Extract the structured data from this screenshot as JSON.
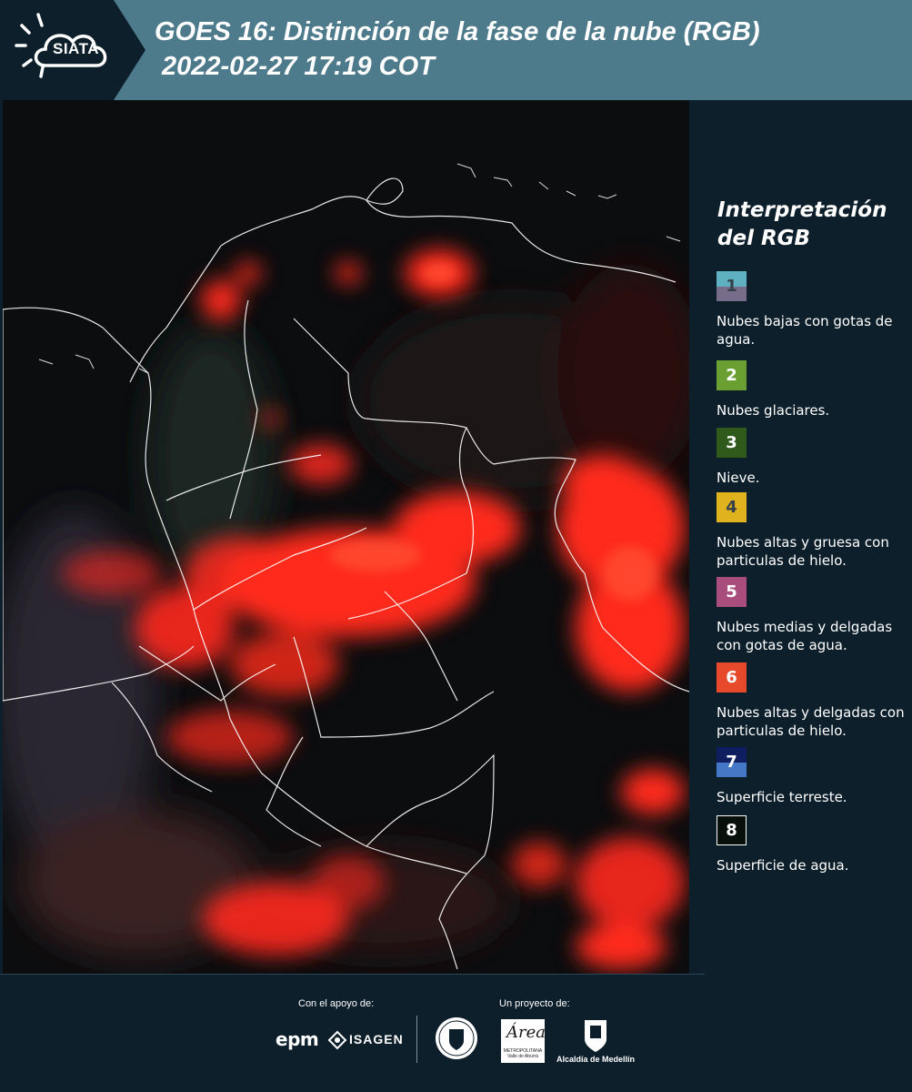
{
  "header": {
    "logo_text": "SIATA",
    "title": "GOES 16: Distinción de la fase de la nube (RGB)",
    "timestamp": "2022-02-27 17:19 COT"
  },
  "legend": {
    "title": "Interpretación del RGB",
    "items": [
      {
        "number": "1",
        "label": "Nubes bajas con gotas de agua.",
        "colors": [
          "#5fb0c0",
          "#776d8a"
        ]
      },
      {
        "number": "2",
        "label": "Nubes glaciares.",
        "colors": [
          "#6aa032"
        ]
      },
      {
        "number": "3",
        "label": "Nieve.",
        "colors": [
          "#2f5a1c"
        ]
      },
      {
        "number": "4",
        "label": "Nubes altas y gruesa con particulas de hielo.",
        "colors": [
          "#e0b21d"
        ]
      },
      {
        "number": "5",
        "label": "Nubes medias y delgadas con gotas de agua.",
        "colors": [
          "#a84d7c"
        ]
      },
      {
        "number": "6",
        "label": "Nubes altas y delgadas con particulas de hielo.",
        "colors": [
          "#e64a2a"
        ]
      },
      {
        "number": "7",
        "label": "Superficie terreste.",
        "colors": [
          "#0e1e60",
          "#4478c6"
        ]
      },
      {
        "number": "8",
        "label": "Superficie de agua.",
        "colors": [
          "#08100c"
        ]
      }
    ]
  },
  "footer": {
    "support_label": "Con el apoyo de:",
    "project_label": "Un proyecto de:",
    "sponsors": [
      "epm",
      "ISAGEN"
    ],
    "partner_logo_texts": [
      "METROPOLITANA Valle de Aburrá",
      "Alcaldía de Medellín"
    ]
  },
  "colors": {
    "header_bg": "#4e7b8c",
    "logo_bg": "#0d1f2b",
    "page_bg": "#0d1f2b",
    "cloud_red": "#ff2a1c"
  }
}
